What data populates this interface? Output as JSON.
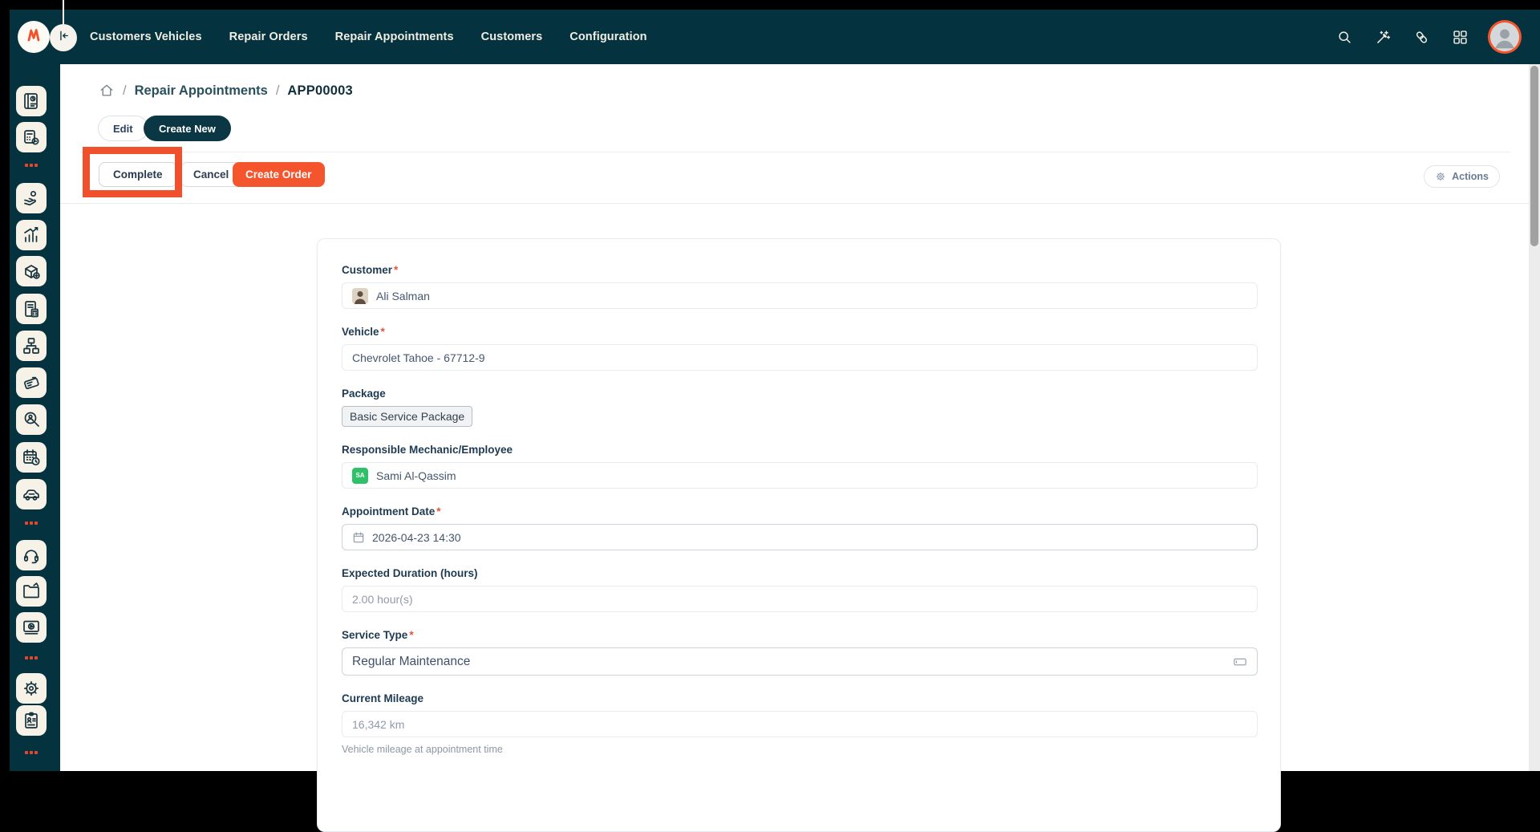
{
  "ui": {
    "required_mark": "*",
    "breadcrumb_separator": "/"
  },
  "topbar": {
    "menu_items": [
      "Customers Vehicles",
      "Repair Orders",
      "Repair Appointments",
      "Customers",
      "Configuration"
    ],
    "action_icons": [
      "search-icon",
      "magic-wand-icon",
      "attachment-link-icon",
      "apps-grid-icon"
    ],
    "logo_icon": "logo-mark-icon",
    "collapse_icon": "collapse-left-icon",
    "avatar_icon": "user-avatar-icon"
  },
  "sidebar": {
    "items": [
      {
        "type": "app",
        "icon": "planner-book-icon"
      },
      {
        "type": "app",
        "icon": "calculator-coin-icon"
      },
      {
        "type": "divider"
      },
      {
        "type": "app",
        "icon": "hand-coin-icon"
      },
      {
        "type": "app",
        "icon": "growth-chart-icon"
      },
      {
        "type": "app",
        "icon": "package-plus-icon"
      },
      {
        "type": "app",
        "icon": "clipboard-calculator-icon"
      },
      {
        "type": "app",
        "icon": "org-chart-icon"
      },
      {
        "type": "app",
        "icon": "card-terminal-icon"
      },
      {
        "type": "app",
        "icon": "person-search-icon"
      },
      {
        "type": "app",
        "icon": "calendar-clock-icon"
      },
      {
        "type": "app",
        "icon": "car-icon"
      },
      {
        "type": "divider"
      },
      {
        "type": "app",
        "icon": "headset-icon"
      },
      {
        "type": "app",
        "icon": "folder-document-icon"
      },
      {
        "type": "app",
        "icon": "screen-presentation-icon"
      },
      {
        "type": "divider"
      },
      {
        "type": "app",
        "icon": "settings-gear-icon"
      },
      {
        "type": "app",
        "icon": "id-card-icon"
      },
      {
        "type": "divider"
      }
    ]
  },
  "breadcrumb": {
    "section": "Repair Appointments",
    "current": "APP00003"
  },
  "header_actions": {
    "edit": "Edit",
    "create_new": "Create New"
  },
  "status_bar": {
    "complete": "Complete",
    "cancel": "Cancel",
    "create_order": "Create Order",
    "actions": "Actions"
  },
  "form": {
    "fields": {
      "customer": {
        "label": "Customer",
        "required": true,
        "value": "Ali Salman"
      },
      "vehicle": {
        "label": "Vehicle",
        "required": true,
        "value": "Chevrolet Tahoe - 67712-9"
      },
      "package": {
        "label": "Package",
        "tag": "Basic Service Package"
      },
      "mechanic": {
        "label": "Responsible Mechanic/Employee",
        "value": "Sami Al-Qassim",
        "avatar_initials": "SA"
      },
      "appointment_date": {
        "label": "Appointment Date",
        "required": true,
        "value": "2026-04-23 14:30"
      },
      "duration": {
        "label": "Expected Duration (hours)",
        "value": "2.00 hour(s)"
      },
      "service_type": {
        "label": "Service Type",
        "required": true,
        "value": "Regular Maintenance"
      },
      "mileage": {
        "label": "Current Mileage",
        "value": "16,342 km",
        "help": "Vehicle mileage at appointment time"
      }
    }
  },
  "colors": {
    "topbar_bg": "#04323e",
    "accent_orange": "#f4552d",
    "annotation_highlight": "#f1502d",
    "tile_bg": "#f7f2e7",
    "create_new_bg": "#0a3743",
    "mechanic_avatar_green": "#2fc168",
    "required_red": "#e5533d"
  }
}
